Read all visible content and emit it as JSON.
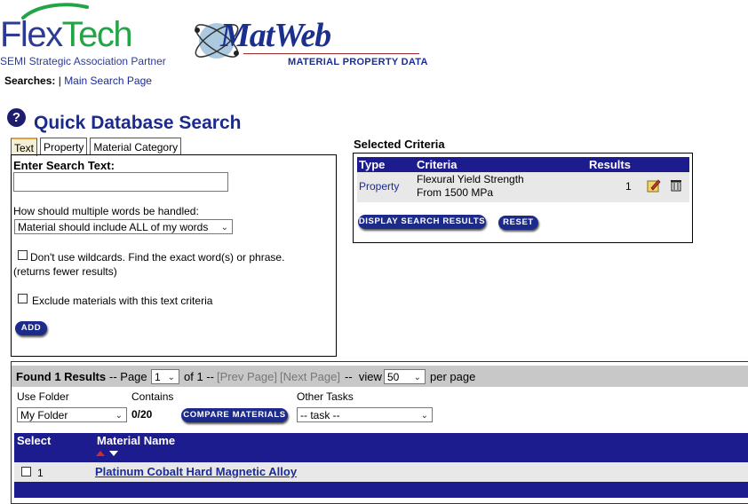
{
  "header": {
    "flextech_flex": "Flex",
    "flextech_tech": "Tech",
    "flextech_subtitle": "SEMI Strategic Association Partner",
    "matweb_logo": "MatWeb",
    "matweb_subtitle": "MATERIAL PROPERTY DATA"
  },
  "searches": {
    "label": "Searches:",
    "separator": "|",
    "main_link": "Main Search Page"
  },
  "page_title": "Quick Database Search",
  "help_icon_glyph": "?",
  "tabs": [
    "Text",
    "Property",
    "Material Category"
  ],
  "active_tab": "Text",
  "search_panel": {
    "enter_label": "Enter Search Text:",
    "search_value": "",
    "multi_word_label": "How should multiple words be handled:",
    "multi_word_selected": "Material should include ALL of my words",
    "wildcards_label": "Don't use wildcards. Find the exact word(s) or phrase.",
    "wildcards_note": "(returns fewer results)",
    "exclude_label": "Exclude materials with this text criteria",
    "add_button": "ADD"
  },
  "selected_criteria": {
    "title": "Selected Criteria",
    "headers": {
      "type": "Type",
      "criteria": "Criteria",
      "results": "Results"
    },
    "row": {
      "type": "Property",
      "criteria_line1": "Flexural Yield Strength",
      "criteria_line2": "From 1500 MPa",
      "results": "1"
    },
    "display_button": "DISPLAY SEARCH RESULTS",
    "reset_button": "RESET"
  },
  "results": {
    "found_text": "Found 1 Results",
    "page_label": "-- Page",
    "page_value": "1",
    "of_text": "of 1 --",
    "prev_page": "[Prev Page]",
    "next_page": "[Next Page]",
    "dash_view": "--  view",
    "per_page_value": "50",
    "per_page_label": "per page",
    "use_folder_label": "Use Folder",
    "contains_label": "Contains",
    "other_tasks_label": "Other Tasks",
    "folder_selected": "My Folder",
    "contains_value": "0/20",
    "compare_button": "COMPARE MATERIALS",
    "task_selected": "-- task --",
    "col_select": "Select",
    "col_material": "Material Name",
    "rows": [
      {
        "index": "1",
        "name": "Platinum Cobalt Hard Magnetic Alloy"
      }
    ]
  },
  "colors": {
    "brand_navy": "#1c1c8f",
    "link_blue": "#1a2a9a",
    "row_grey": "#e8e8e8",
    "bar_grey": "#c8c8c8",
    "sort_up_red": "#d32b2b"
  }
}
